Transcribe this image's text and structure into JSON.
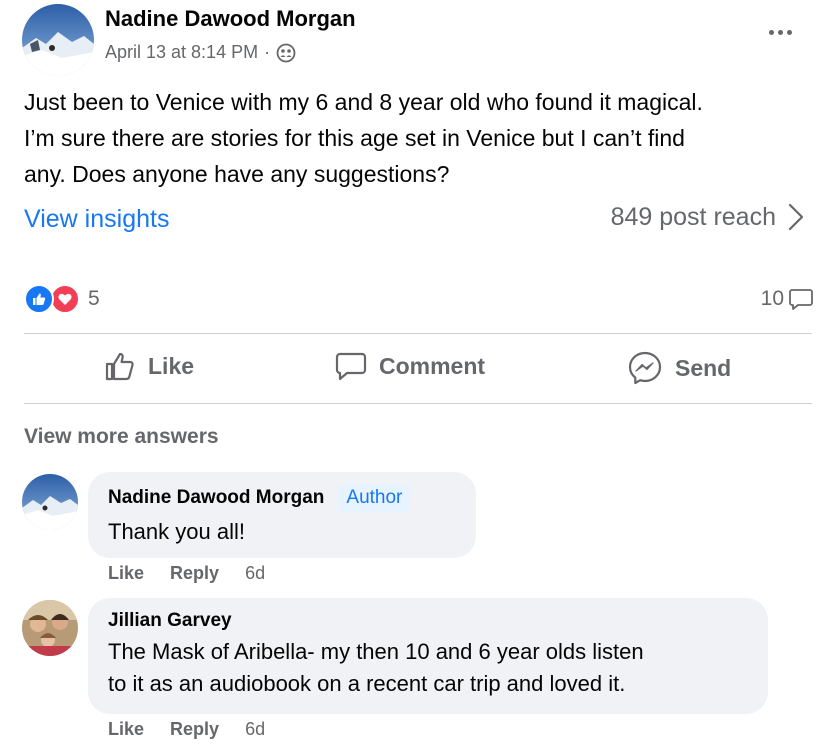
{
  "post": {
    "author": "Nadine Dawood Morgan",
    "timestamp": "April 13 at 8:14 PM",
    "separator": "·",
    "audience_icon": "group-icon",
    "text_lines": [
      "Just been to Venice with my 6 and 8 year old who found it magical.",
      "I’m sure there are stories for this age set in Venice but I can’t find",
      "any. Does anyone have any suggestions?"
    ],
    "insights_label": "View insights",
    "reach_text": "849 post reach",
    "reaction_count": "5",
    "comment_count": "10"
  },
  "actions": {
    "like": "Like",
    "comment": "Comment",
    "send": "Send"
  },
  "view_more": "View more answers",
  "comments": [
    {
      "name": "Nadine Dawood Morgan",
      "badge": "Author",
      "lines": [
        "Thank you all!"
      ],
      "like": "Like",
      "reply": "Reply",
      "time": "6d"
    },
    {
      "name": "Jillian Garvey",
      "lines": [
        "The Mask of Aribella- my then 10 and 6 year olds listen",
        "to it as an audiobook on a recent car trip and loved it."
      ],
      "like": "Like",
      "reply": "Reply",
      "time": "6d"
    }
  ],
  "colors": {
    "accent": "#1877f2",
    "secondary_text": "#65676b",
    "bubble": "#f0f2f5",
    "love": "#f33e58"
  }
}
